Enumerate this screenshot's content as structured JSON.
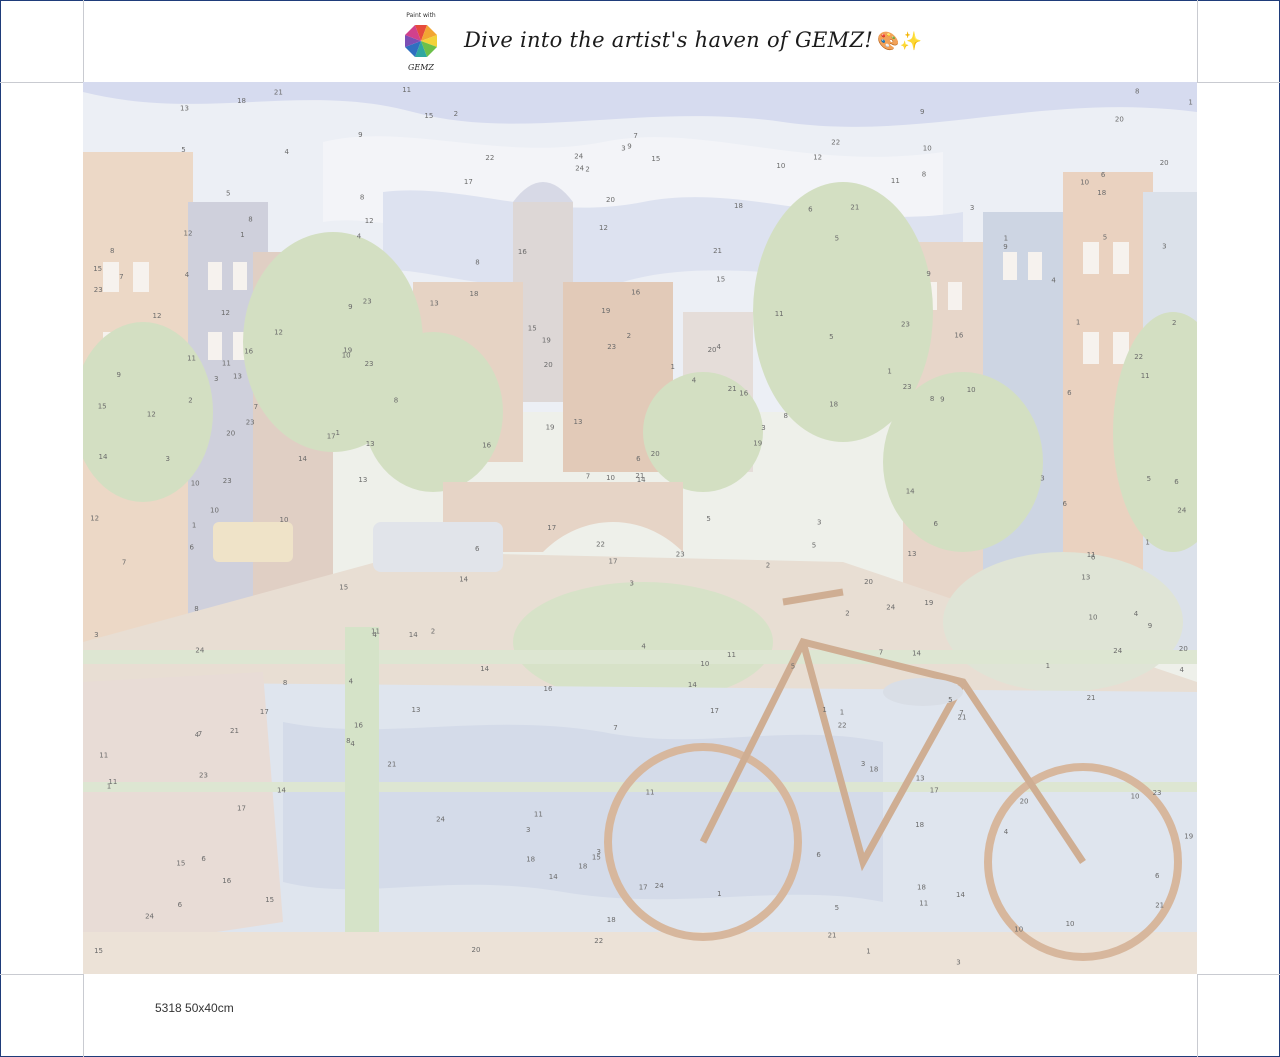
{
  "header": {
    "logo_text_top": "Paint with",
    "logo_text_bottom": "GEMZ",
    "tagline": "Dive into the artist's haven of GEMZ!",
    "tagline_emoji": "🎨✨"
  },
  "footer": {
    "product_code": "5318 50x40cm"
  },
  "canvas": {
    "numbers": [
      "1",
      "2",
      "3",
      "4",
      "5",
      "6",
      "7",
      "8",
      "9",
      "10",
      "11",
      "12",
      "13",
      "14",
      "15",
      "16",
      "17",
      "18",
      "19",
      "20",
      "21",
      "22",
      "23",
      "24"
    ]
  },
  "colors": {
    "frame": "#1f3c7a",
    "sky": "#e9ecf3",
    "cloud_blue": "#c9cfe6",
    "tree_green": "#cfdcc0",
    "building_peach": "#ead9c8",
    "building_grey": "#c7c9d6",
    "water": "#d3dbe8",
    "bike": "#d8b9a0"
  }
}
